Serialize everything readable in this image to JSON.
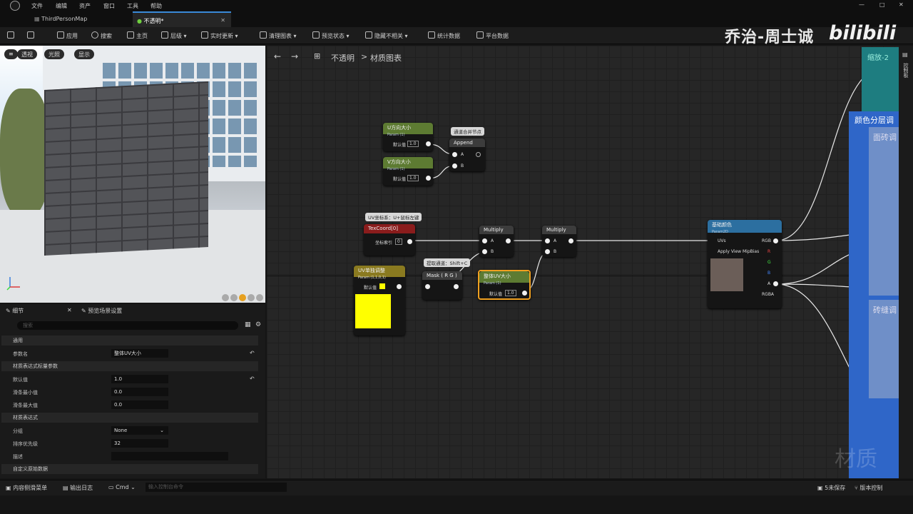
{
  "menu": [
    "文件",
    "编辑",
    "资产",
    "窗口",
    "工具",
    "帮助"
  ],
  "tabs": [
    {
      "label": "ThirdPersonMap"
    },
    {
      "label": "不透明*"
    }
  ],
  "toolbar": {
    "apply": "应用",
    "search": "搜索",
    "home": "主页",
    "hierarchy": "层级",
    "live_update": "实时更新",
    "clean_graph": "清理图表",
    "preview_state": "预览状态",
    "hide_unrelated": "隐藏不相关",
    "stats": "统计数据",
    "platform_stats": "平台数据"
  },
  "watermark": {
    "author": "乔治-周士诚",
    "brand": "bilibili"
  },
  "viewport": {
    "perspective": "透视",
    "lit": "光照",
    "show": "显示"
  },
  "details": {
    "tab_details": "细节",
    "tab_preview": "预览场景设置",
    "search_placeholder": "搜索",
    "cat_general": "通用",
    "param_name_label": "参数名",
    "param_name_value": "整体UV大小",
    "cat_scalar": "材质表达式标量参数",
    "default_label": "默认值",
    "default_value": "1.0",
    "slider_min_label": "滑条最小值",
    "slider_min_value": "0.0",
    "slider_max_label": "滑条最大值",
    "slider_max_value": "0.0",
    "cat_expression": "材质表达式",
    "group_label": "分组",
    "group_value": "None",
    "sort_label": "排序优先级",
    "sort_value": "32",
    "desc_label": "描述",
    "cat_custom": "自定义原始数据"
  },
  "graph": {
    "breadcrumb_root": "不透明",
    "breadcrumb_sep": ">",
    "breadcrumb_leaf": "材质图表",
    "right_panel": "控制板",
    "layer_title": "颜色分层调",
    "face_title": "面砖调",
    "brick_title": "砖缝调",
    "corner_watermark": "材质",
    "top_title": "缩放-2",
    "n_u": {
      "title": "U方向大小",
      "sub": "Param (1)",
      "field": "默认值",
      "value": "1.0"
    },
    "n_v": {
      "title": "V方向大小",
      "sub": "Param (1)",
      "field": "默认值",
      "value": "1.0"
    },
    "c_append": "通道合并节点",
    "n_append": {
      "title": "Append",
      "a": "A",
      "b": "B"
    },
    "c_uv": "UV坐标系：U+鼠标左键",
    "n_tex": {
      "title": "TexCoord[0]",
      "field": "坐标索引",
      "value": "0"
    },
    "n_mul1": {
      "title": "Multiply",
      "a": "A",
      "b": "B"
    },
    "n_mul2": {
      "title": "Multiply",
      "a": "A",
      "b": "B"
    },
    "c_mask": "提取通道：Shift+C",
    "n_uvbias": {
      "title": "UV单独调整",
      "sub": "Param (1,1,0,1)",
      "field": "默认值"
    },
    "n_mask": {
      "title": "Mask ( R G )"
    },
    "n_scale": {
      "title": "整体UV大小",
      "sub": "Param (1)",
      "field": "默认值",
      "value": "1.0"
    },
    "n_base": {
      "title": "基础颜色",
      "sub": "Param2D",
      "uvs": "UVs",
      "mip": "Apply View MipBias",
      "rgb": "RGB",
      "r": "R",
      "g": "G",
      "b": "B",
      "a": "A",
      "rgba": "RGBA"
    }
  },
  "status": {
    "drawer": "内容侧滑菜单",
    "log": "输出日志",
    "cmd": "Cmd",
    "cmd_placeholder": "输入控制台命令",
    "unsaved": "5未保存",
    "source_control": "版本控制"
  },
  "colors": {
    "accent_blue": "#2f66c8",
    "param_green": "#5d7b32",
    "tex_red": "#8a1c1c",
    "vector_yellow": "#8a7a20",
    "node_orange": "#f0a020",
    "texture_blue": "#2c6fa0"
  }
}
